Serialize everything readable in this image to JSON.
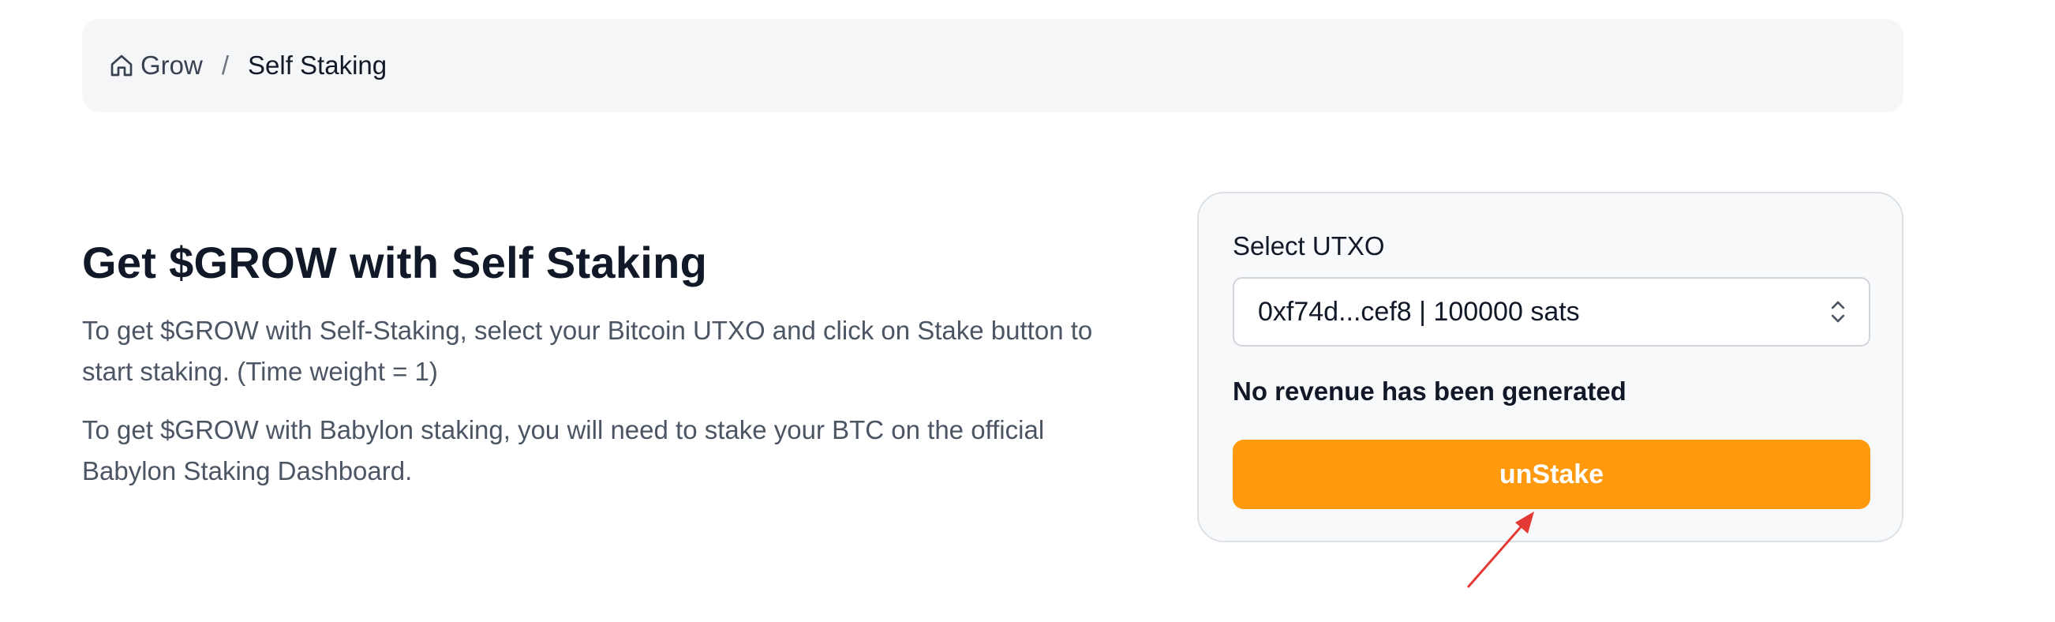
{
  "breadcrumb": {
    "home_label": "Grow",
    "separator": "/",
    "current_label": "Self Staking",
    "home_icon": "home-icon"
  },
  "main": {
    "title": "Get $GROW with Self Staking",
    "paragraph1": "To get $GROW with Self-Staking, select your Bitcoin UTXO and click on Stake button to start staking. (Time weight = 1)",
    "paragraph2": "To get $GROW with Babylon staking, you will need to stake your BTC on the official Babylon Staking Dashboard."
  },
  "card": {
    "utxo_label": "Select UTXO",
    "utxo_selected": "0xf74d...cef8 | 100000 sats",
    "chevron_icon": "chevron-up-down-icon",
    "revenue_text": "No revenue has been generated",
    "unstake_label": "unStake"
  },
  "colors": {
    "accent": "#ff9a0f",
    "annotation": "#e53935"
  }
}
